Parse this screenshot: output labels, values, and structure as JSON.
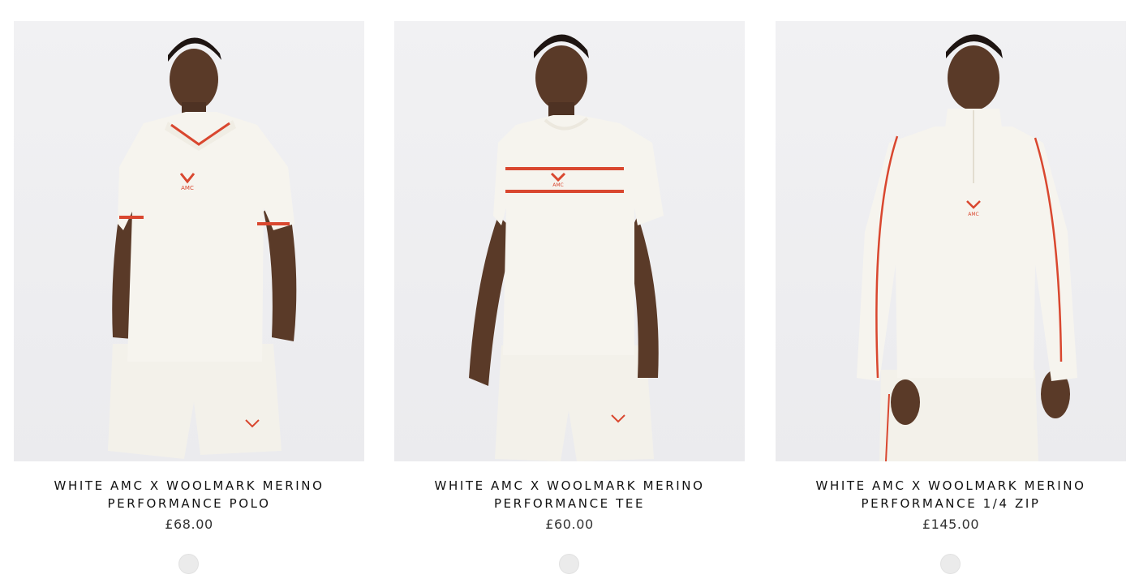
{
  "products": [
    {
      "title_line1": "WHITE AMC X WOOLMARK MERINO",
      "title_line2": "PERFORMANCE POLO",
      "price": "£68.00",
      "logo_text": "AMC",
      "image_icon": "model-wearing-polo-image",
      "swatch_color": "#ebebeb"
    },
    {
      "title_line1": "WHITE AMC X WOOLMARK MERINO",
      "title_line2": "PERFORMANCE TEE",
      "price": "£60.00",
      "logo_text": "AMC",
      "image_icon": "model-wearing-tee-image",
      "swatch_color": "#ebebeb"
    },
    {
      "title_line1": "WHITE AMC X WOOLMARK MERINO",
      "title_line2": "PERFORMANCE 1/4 ZIP",
      "price": "£145.00",
      "logo_text": "AMC",
      "image_icon": "model-wearing-quarter-zip-image",
      "swatch_color": "#ebebeb"
    }
  ],
  "colors": {
    "garment": "#f6f4ee",
    "accent_stripe": "#d9472f",
    "skin": "#5a3a28",
    "background": "#eeeef1"
  }
}
